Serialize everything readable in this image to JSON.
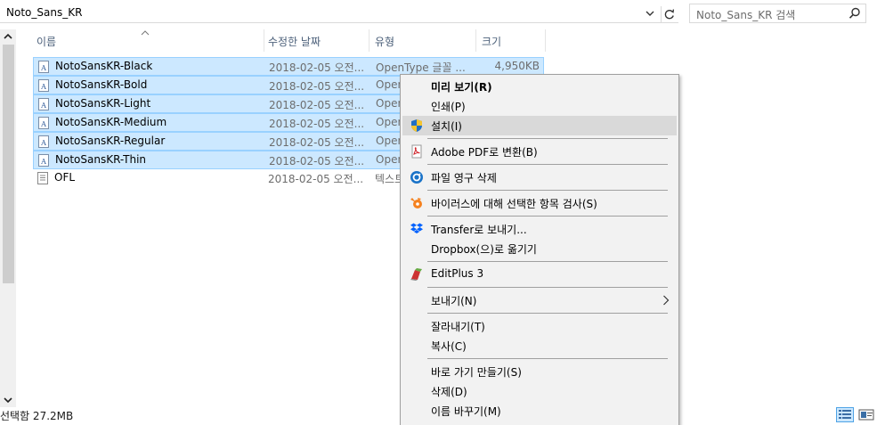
{
  "address_bar": {
    "path": "Noto_Sans_KR"
  },
  "search": {
    "placeholder": "Noto_Sans_KR 검색"
  },
  "columns": {
    "name": "이름",
    "date": "수정한 날짜",
    "type": "유형",
    "size": "크기"
  },
  "files": [
    {
      "name": "NotoSansKR-Black",
      "date": "2018-02-05 오전...",
      "type": "OpenType 글꼴 ...",
      "size": "4,950KB",
      "selected": true,
      "icon": "font-file-icon"
    },
    {
      "name": "NotoSansKR-Bold",
      "date": "2018-02-05 오전...",
      "type": "Open",
      "size": "",
      "selected": true,
      "icon": "font-file-icon"
    },
    {
      "name": "NotoSansKR-Light",
      "date": "2018-02-05 오전...",
      "type": "Open",
      "size": "",
      "selected": true,
      "icon": "font-file-icon"
    },
    {
      "name": "NotoSansKR-Medium",
      "date": "2018-02-05 오전...",
      "type": "Open",
      "size": "",
      "selected": true,
      "icon": "font-file-icon"
    },
    {
      "name": "NotoSansKR-Regular",
      "date": "2018-02-05 오전...",
      "type": "Open",
      "size": "",
      "selected": true,
      "icon": "font-file-icon"
    },
    {
      "name": "NotoSansKR-Thin",
      "date": "2018-02-05 오전...",
      "type": "Open",
      "size": "",
      "selected": true,
      "icon": "font-file-icon"
    },
    {
      "name": "OFL",
      "date": "2018-02-05 오전...",
      "type": "텍스트",
      "size": "",
      "selected": false,
      "icon": "text-file-icon"
    }
  ],
  "status": {
    "text": "선택함 27.2MB"
  },
  "context_menu": {
    "preview": "미리 보기(R)",
    "print": "인쇄(P)",
    "install": "설치(I)",
    "adobe_pdf": "Adobe PDF로 변환(B)",
    "permanent_delete": "파일 영구 삭제",
    "virus_scan": "바이러스에 대해 선택한 항목 검사(S)",
    "transfer": "Transfer로 보내기...",
    "dropbox_move": "Dropbox(으)로 옮기기",
    "editplus": "EditPlus 3",
    "send_to": "보내기(N)",
    "cut": "잘라내기(T)",
    "copy": "복사(C)",
    "shortcut": "바로 가기 만들기(S)",
    "delete": "삭제(D)",
    "rename": "이름 바꾸기(M)"
  },
  "colors": {
    "selection_bg": "#cce8ff",
    "selection_border": "#99d1ff",
    "menu_bg": "#f2f2f2",
    "menu_highlight": "#d9d9d9"
  }
}
